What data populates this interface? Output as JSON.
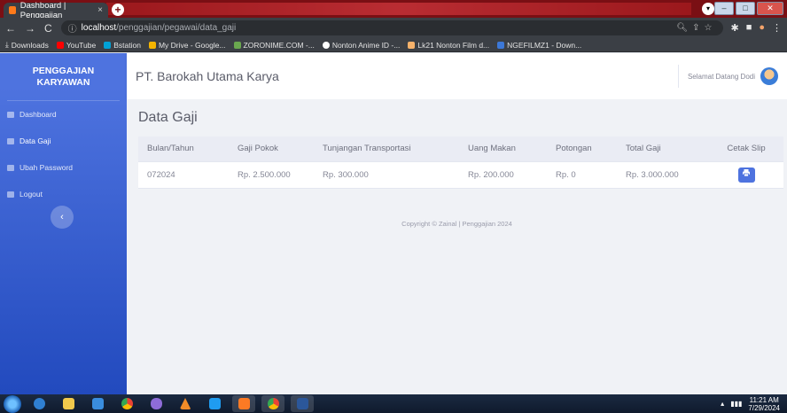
{
  "browser": {
    "tab_title": "Dashboard | Penggajian",
    "tab_close": "×",
    "new_tab": "+",
    "url_host": "localhost",
    "url_path": "/penggajian/pegawai/data_gaji",
    "bookmarks": [
      {
        "label": "Downloads",
        "color": "#bfbfbf"
      },
      {
        "label": "YouTube",
        "color": "#ff0000"
      },
      {
        "label": "Bstation",
        "color": "#00a1d6"
      },
      {
        "label": "My Drive - Google...",
        "color": "#f4b400"
      },
      {
        "label": "ZORONIME.COM -...",
        "color": "#6aa84f"
      },
      {
        "label": "Nonton Anime ID -...",
        "color": "#ffffff"
      },
      {
        "label": "Lk21 Nonton Film d...",
        "color": "#f6b26b"
      },
      {
        "label": "NGEFILMZ1 - Down...",
        "color": "#3c78d8"
      }
    ]
  },
  "sidebar": {
    "brand_line1": "PENGGAJIAN",
    "brand_line2": "KARYAWAN",
    "items": [
      {
        "label": "Dashboard",
        "icon": "dashboard-icon"
      },
      {
        "label": "Data Gaji",
        "icon": "table-icon"
      },
      {
        "label": "Ubah Password",
        "icon": "lock-icon"
      },
      {
        "label": "Logout",
        "icon": "logout-icon"
      }
    ],
    "toggle": "‹"
  },
  "topbar": {
    "company": "PT. Barokah Utama Karya",
    "greeting": "Selamat Datang Dodi"
  },
  "main": {
    "title": "Data Gaji",
    "columns": [
      "Bulan/Tahun",
      "Gaji Pokok",
      "Tunjangan Transportasi",
      "Uang Makan",
      "Potongan",
      "Total Gaji",
      "Cetak Slip"
    ],
    "rows": [
      {
        "period": "072024",
        "basic": "Rp. 2.500.000",
        "transport": "Rp. 300.000",
        "meal": "Rp. 200.000",
        "deduction": "Rp. 0",
        "total": "Rp. 3.000.000"
      }
    ],
    "footer": "Copyright © Zainal | Penggajian 2024"
  },
  "taskbar": {
    "time": "11:21 AM",
    "date": "7/29/2024"
  },
  "colors": {
    "sidebar_top": "#4e73df",
    "sidebar_bottom": "#224abe",
    "print_button": "#4e73df"
  }
}
